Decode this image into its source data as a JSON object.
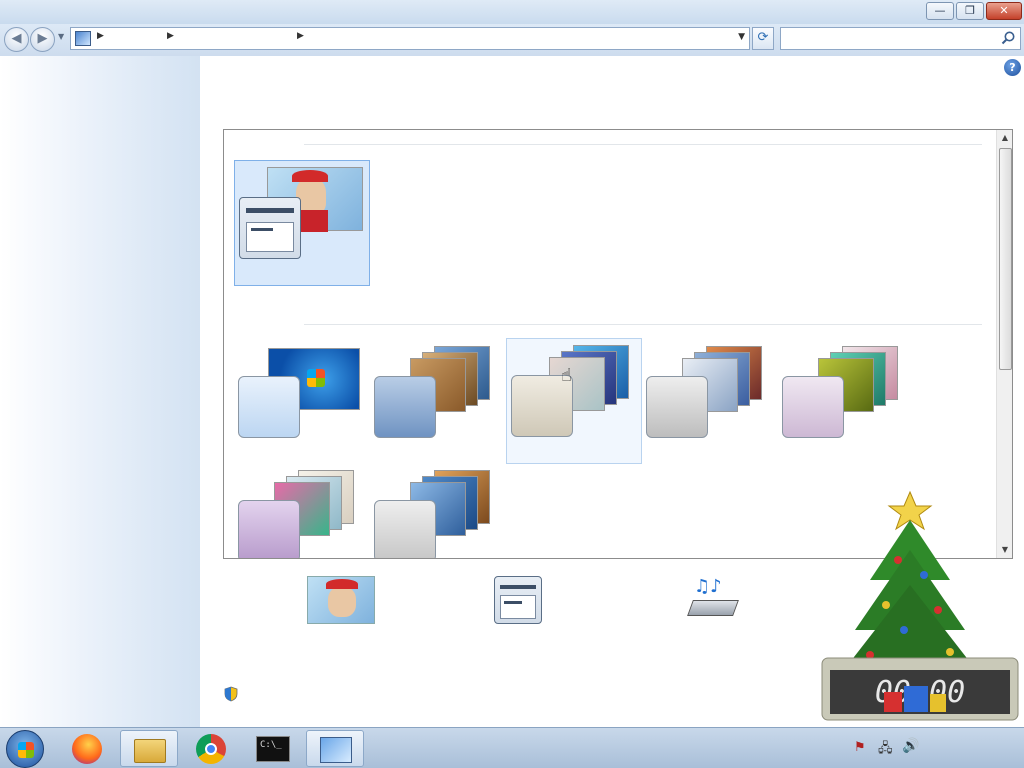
{
  "window": {
    "controls": {
      "minimize": "—",
      "maximize": "❐",
      "close": "✕"
    }
  },
  "address": {
    "breadcrumb": [
      "",
      "",
      ""
    ],
    "search_placeholder": ""
  },
  "sidebar": {
    "home": "",
    "tasks": [
      "",
      "",
      ""
    ],
    "see_also_heading": "",
    "see_also": [
      "",
      "",
      ""
    ]
  },
  "main": {
    "title": "",
    "description": "",
    "my_themes": {
      "heading": "",
      "items": [
        {
          "label": ""
        }
      ]
    },
    "links": {
      "save_theme": "",
      "get_more": ""
    },
    "aero_themes": {
      "heading": "",
      "items": [
        {
          "label": ""
        },
        {
          "label": ""
        },
        {
          "label": ""
        },
        {
          "label": ""
        },
        {
          "label": ""
        },
        {
          "label": ""
        },
        {
          "label": ""
        }
      ]
    },
    "settings": [
      {
        "label": "",
        "value": ""
      },
      {
        "label": "",
        "value": ""
      },
      {
        "label": "",
        "value": ""
      }
    ],
    "troubleshoot_link": ""
  },
  "taskbar": {
    "clock_time": "",
    "clock_date": ""
  },
  "colors": {
    "link": "#1f5fbf",
    "title_blue": "#1f4d8c",
    "selected_bg": "#d9e9fb"
  }
}
